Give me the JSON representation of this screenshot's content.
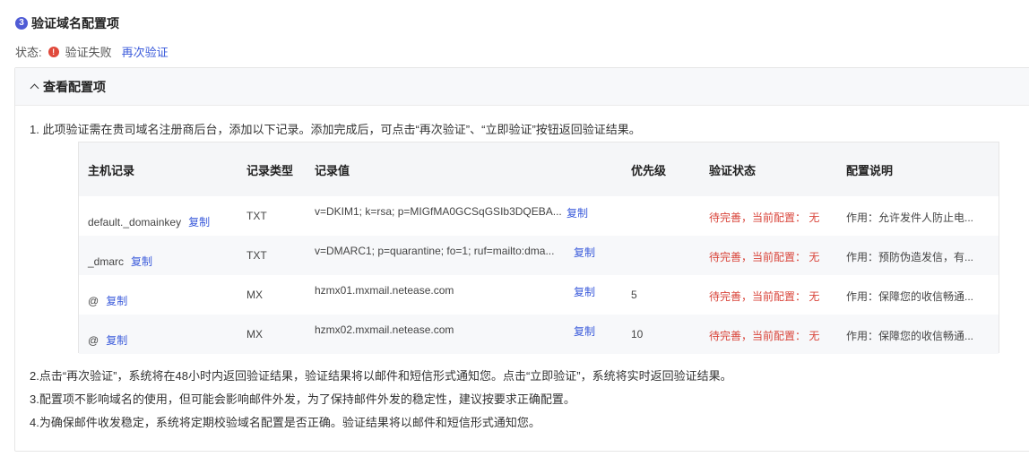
{
  "step": {
    "number": "3",
    "title": "验证域名配置项"
  },
  "status": {
    "label": "状态:",
    "icon": "warning-icon",
    "text": "验证失败",
    "reverify": "再次验证"
  },
  "panel": {
    "title": "查看配置项",
    "note1": "1. 此项验证需在贵司域名注册商后台，添加以下记录。添加完成后，可点击“再次验证”、“立即验证”按钮返回验证结果。",
    "note2": "2.点击“再次验证”，系统将在48小时内返回验证结果，验证结果将以邮件和短信形式通知您。点击“立即验证”，系统将实时返回验证结果。",
    "note3": "3.配置项不影响域名的使用，但可能会影响邮件外发，为了保持邮件外发的稳定性，建议按要求正确配置。",
    "note4": "4.为确保邮件收发稳定，系统将定期校验域名配置是否正确。验证结果将以邮件和短信形式通知您。"
  },
  "table": {
    "headers": [
      "主机记录",
      "记录类型",
      "记录值",
      "优先级",
      "验证状态",
      "配置说明"
    ],
    "copy_label": "复制",
    "rows": [
      {
        "host": "default._domainkey",
        "type": "TXT",
        "value": "v=DKIM1; k=rsa; p=MIGfMA0GCSqGSIb3DQEBA...",
        "priority": "",
        "status": "待完善，当前配置： 无",
        "desc": "作用：允许发件人防止电..."
      },
      {
        "host": "_dmarc",
        "type": "TXT",
        "value": "v=DMARC1; p=quarantine; fo=1; ruf=mailto:dma...",
        "priority": "",
        "status": "待完善，当前配置： 无",
        "desc": "作用：预防伪造发信，有..."
      },
      {
        "host": "@",
        "type": "MX",
        "value": "hzmx01.mxmail.netease.com",
        "priority": "5",
        "status": "待完善，当前配置： 无",
        "desc": "作用：保障您的收信畅通..."
      },
      {
        "host": "@",
        "type": "MX",
        "value": "hzmx02.mxmail.netease.com",
        "priority": "10",
        "status": "待完善，当前配置： 无",
        "desc": "作用：保障您的收信畅通..."
      }
    ]
  }
}
